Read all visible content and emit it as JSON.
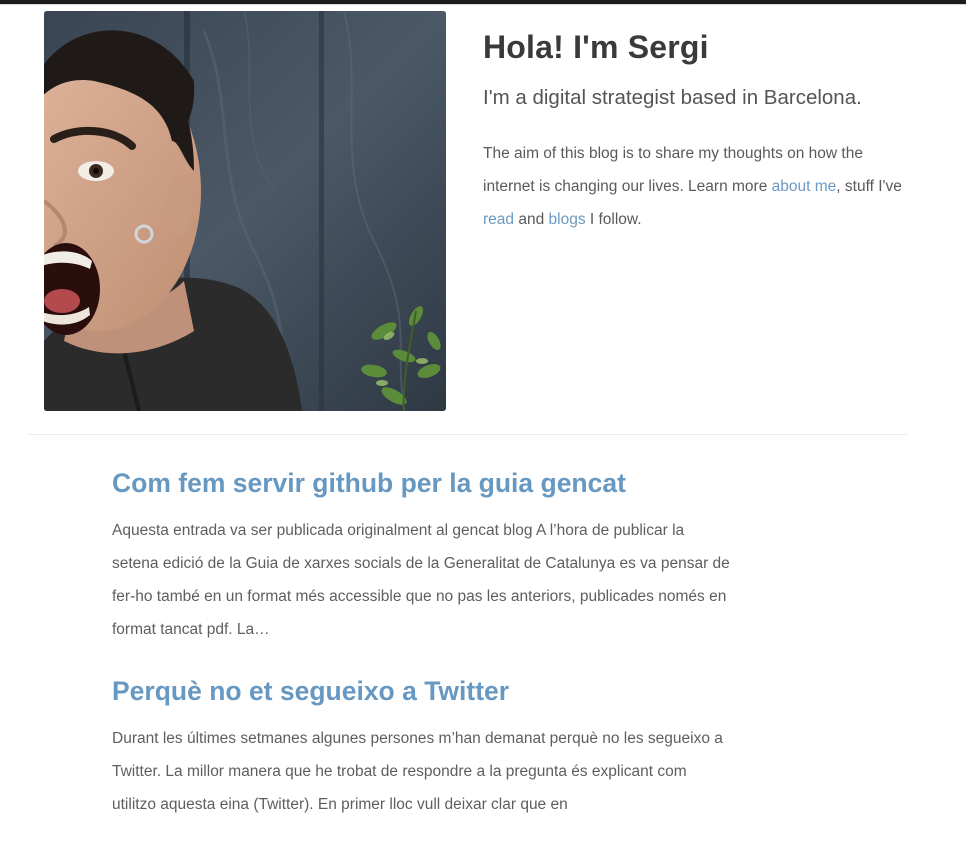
{
  "header": {
    "title": "Hola! I'm Sergi",
    "tagline": "I'm a digital strategist based in Barcelona.",
    "bio": {
      "part1": "The aim of this blog is to share my thoughts on how the internet is changing our lives. Learn more ",
      "link_about": "about me",
      "part2": ", stuff I've ",
      "link_read": "read",
      "part3": " and ",
      "link_blogs": "blogs",
      "part4": " I follow."
    }
  },
  "posts": [
    {
      "title": "Com fem servir github per la guia gencat",
      "excerpt": "Aquesta entrada va ser publicada originalment al gencat blog A l’hora de publicar la setena edició de la Guia de xarxes socials de la Generalitat de Catalunya es va pensar de fer-ho també en un format més accessible que no pas les anteriors, publicades només en format tancat pdf. La…"
    },
    {
      "title": "Perquè no et segueixo a Twitter",
      "excerpt": "Durant les últimes setmanes algunes persones m’han demanat perquè no les segueixo a Twitter. La millor manera que he trobat de respondre a la pregunta és explicant com utilitzo aquesta eina (Twitter). En primer lloc vull deixar clar que en"
    }
  ],
  "colors": {
    "link": "#6a9ac3",
    "post_title": "#6698c2",
    "heading": "#3a3a3a",
    "body_text": "#5e5e5e"
  }
}
